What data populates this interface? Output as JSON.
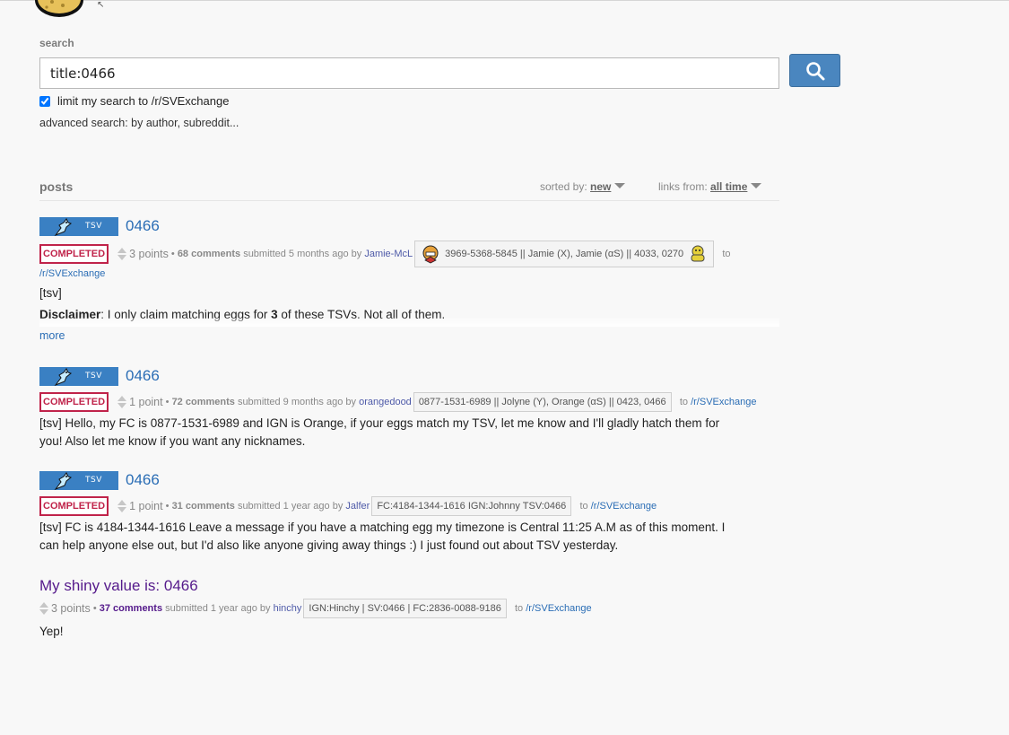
{
  "search": {
    "label": "search",
    "query": "title:0466",
    "limit_label": "limit my search to /r/SVExchange",
    "limit_checked": true,
    "advanced": "advanced search: by author, subreddit..."
  },
  "posts_header": {
    "title": "posts",
    "sorted_by_label": "sorted by:",
    "sorted_by_value": "new",
    "links_from_label": "links from:",
    "links_from_value": "all time"
  },
  "results": [
    {
      "flair": "TSV",
      "title": "0466",
      "status": "COMPLETED",
      "points": "3 points",
      "comments": "68 comments",
      "submitted": "submitted 5 months ago by",
      "author": "Jamie-McL",
      "user_flair": "3969-5368-5845 || Jamie (X), Jamie (αS) || 4033, 0270",
      "to": "to",
      "subreddit": "/r/SVExchange",
      "body1": "[tsv]",
      "body2_bold": "Disclaimer",
      "body2_a": ": I only claim matching eggs for ",
      "body2_b": "3",
      "body2_c": " of these TSVs. Not all of them.",
      "more": "more"
    },
    {
      "flair": "TSV",
      "title": "0466",
      "status": "COMPLETED",
      "points": "1 point",
      "comments": "72 comments",
      "submitted": "submitted 9 months ago by",
      "author": "orangedood",
      "user_flair": "0877-1531-6989 || Jolyne (Y), Orange (αS) || 0423, 0466",
      "to": "to",
      "subreddit": "/r/SVExchange",
      "body": "[tsv] Hello, my FC is 0877-1531-6989 and IGN is Orange, if your eggs match my TSV, let me know and I'll gladly hatch them for you! Also let me know if you want any nicknames."
    },
    {
      "flair": "TSV",
      "title": "0466",
      "status": "COMPLETED",
      "points": "1 point",
      "comments": "31 comments",
      "submitted": "submitted 1 year ago by",
      "author": "Jalfer",
      "user_flair": "FC:4184-1344-1616 IGN:Johnny TSV:0466",
      "to": "to",
      "subreddit": "/r/SVExchange",
      "body": "[tsv] FC is 4184-1344-1616 Leave a message if you have a matching egg my timezone is Central 11:25 A.M as of this moment. I can help anyone else out, but I'd also like anyone giving away things :) I just found out about TSV yesterday."
    },
    {
      "title": "My shiny value is: 0466",
      "points": "3 points",
      "comments": "37 comments",
      "submitted": "submitted 1 year ago by",
      "author": "hinchy",
      "user_flair": "IGN:Hinchy | SV:0466 | FC:2836-0088-9186",
      "to": "to",
      "subreddit": "/r/SVExchange",
      "body": "Yep!"
    }
  ],
  "colors": {
    "accent": "#3a80c3",
    "link": "#2a6db5",
    "visited": "#551a8b",
    "completed": "#c0234a"
  }
}
